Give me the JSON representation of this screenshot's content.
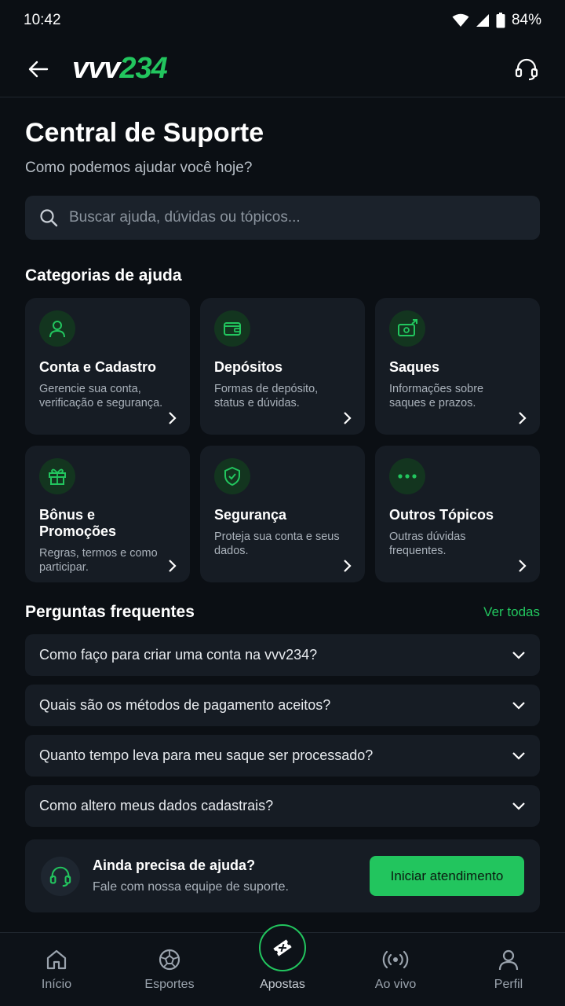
{
  "status_bar": {
    "time": "10:42",
    "battery": "84%"
  },
  "header": {
    "logo_white": "vvv",
    "logo_green": "234"
  },
  "page": {
    "title": "Central de Suporte",
    "subtitle": "Como podemos ajudar você hoje?"
  },
  "search": {
    "placeholder": "Buscar ajuda, dúvidas ou tópicos..."
  },
  "categories": {
    "title": "Categorias de ajuda",
    "items": [
      {
        "icon": "user-icon",
        "title": "Conta e Cadastro",
        "desc": "Gerencie sua conta, verificação e segurança."
      },
      {
        "icon": "wallet-icon",
        "title": "Depósitos",
        "desc": "Formas de depósito, status e dúvidas."
      },
      {
        "icon": "withdraw-icon",
        "title": "Saques",
        "desc": "Informações sobre saques e prazos."
      },
      {
        "icon": "gift-icon",
        "title": "Bônus e Promoções",
        "desc": "Regras, termos e como participar."
      },
      {
        "icon": "shield-check-icon",
        "title": "Segurança",
        "desc": "Proteja sua conta e seus dados."
      },
      {
        "icon": "more-icon",
        "title": "Outros Tópicos",
        "desc": "Outras dúvidas frequentes."
      }
    ]
  },
  "faq": {
    "title": "Perguntas frequentes",
    "see_all": "Ver todas",
    "items": [
      "Como faço para criar uma conta na vvv234?",
      "Quais são os métodos de pagamento aceitos?",
      "Quanto tempo leva para meu saque ser processado?",
      "Como altero meus dados cadastrais?"
    ]
  },
  "help": {
    "title": "Ainda precisa de ajuda?",
    "subtitle": "Fale com nossa equipe de suporte.",
    "button": "Iniciar atendimento"
  },
  "nav": {
    "items": [
      "Início",
      "Esportes",
      "Apostas",
      "Ao vivo",
      "Perfil"
    ]
  },
  "colors": {
    "accent": "#22c55e",
    "background": "#0b0f14",
    "card": "#161c24"
  }
}
